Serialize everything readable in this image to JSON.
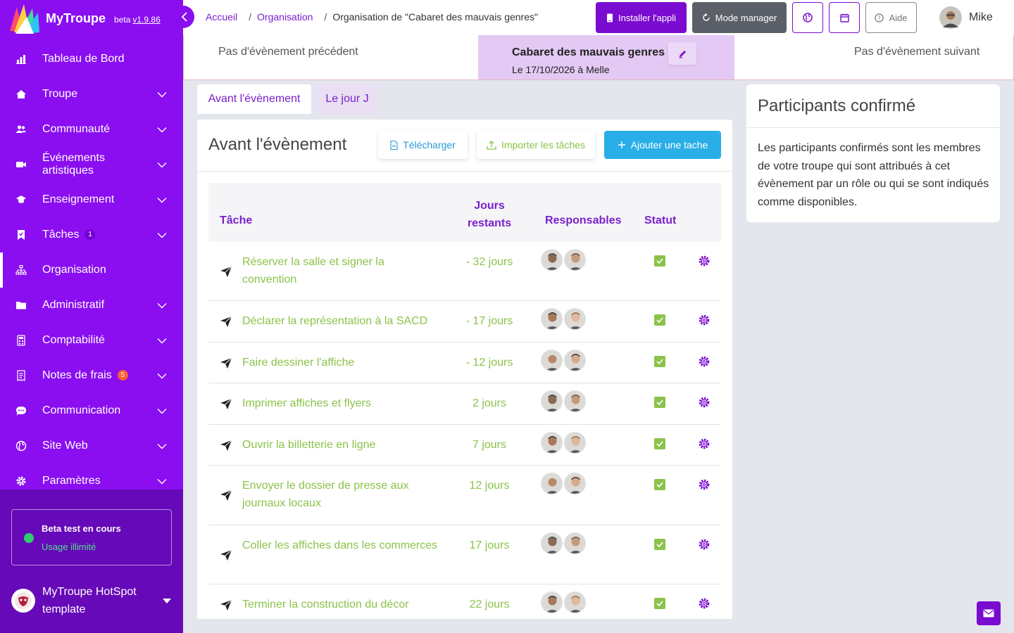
{
  "brand": {
    "name": "MyTroupe",
    "beta": "beta",
    "version": "v1.9.86"
  },
  "nav": [
    {
      "label": "Tableau de Bord",
      "icon": "chart-icon",
      "chevron": false,
      "badge": ""
    },
    {
      "label": "Troupe",
      "icon": "home-icon",
      "chevron": true,
      "badge": ""
    },
    {
      "label": "Communauté",
      "icon": "users-icon",
      "chevron": true,
      "badge": ""
    },
    {
      "label": "Événements artistiques",
      "icon": "video-icon",
      "chevron": true,
      "badge": ""
    },
    {
      "label": "Enseignement",
      "icon": "graduation-icon",
      "chevron": true,
      "badge": ""
    },
    {
      "label": "Tâches",
      "icon": "bookmark-icon",
      "chevron": true,
      "badge": "1"
    },
    {
      "label": "Organisation",
      "icon": "sitemap-icon",
      "chevron": false,
      "badge": "",
      "active": true
    },
    {
      "label": "Administratif",
      "icon": "folder-icon",
      "chevron": true,
      "badge": ""
    },
    {
      "label": "Comptabilité",
      "icon": "calculator-icon",
      "chevron": true,
      "badge": ""
    },
    {
      "label": "Notes de frais",
      "icon": "receipt-icon",
      "chevron": true,
      "badge": "5"
    },
    {
      "label": "Communication",
      "icon": "chat-icon",
      "chevron": true,
      "badge": ""
    },
    {
      "label": "Site Web",
      "icon": "globe-icon",
      "chevron": true,
      "badge": ""
    },
    {
      "label": "Paramètres",
      "icon": "gear-icon",
      "chevron": true,
      "badge": ""
    }
  ],
  "beta_box": {
    "title": "Beta test en cours",
    "subtitle": "Usage illimité"
  },
  "troupe": {
    "name": "MyTroupe HotSpot template"
  },
  "breadcrumb": {
    "home": "Accueil",
    "section": "Organisation",
    "current": "Organisation de \"Cabaret des mauvais genres\""
  },
  "header": {
    "install": "Installer l'appli",
    "manager": "Mode manager",
    "help": "Aide",
    "user": "Mike"
  },
  "event_nav": {
    "prev": "Pas d'évènement précédent",
    "title": "Cabaret des mauvais genres",
    "date": "Le 17/10/2026 à Melle",
    "next": "Pas d'évènement suivant"
  },
  "tabs": {
    "before": "Avant l'évènement",
    "day": "Le jour J"
  },
  "card": {
    "title": "Avant l'évènement",
    "download": "Télécharger",
    "import": "Importer les tâches",
    "add": "Ajouter une tache"
  },
  "table": {
    "headers": {
      "task": "Tâche",
      "days_1": "Jours",
      "days_2": "restants",
      "resp": "Responsables",
      "status": "Statut"
    },
    "rows": [
      {
        "task": "Réserver la salle et signer la convention",
        "days": "- 32 jours",
        "height": 84
      },
      {
        "task": "Déclarer la représentation à la SACD",
        "days": "- 17 jours",
        "height": 59
      },
      {
        "task": "Faire dessiner l'affiche",
        "days": "- 12 jours",
        "height": 58
      },
      {
        "task": "Imprimer affiches et flyers",
        "days": "2 jours",
        "height": 59
      },
      {
        "task": "Ouvrir la billetterie en ligne",
        "days": "7 jours",
        "height": 58
      },
      {
        "task": "Envoyer le dossier de presse aux journaux locaux",
        "days": "12 jours",
        "height": 85
      },
      {
        "task": "Coller les affiches dans les commerces",
        "days": "17 jours",
        "height": 84
      },
      {
        "task": "Terminer la construction du décor",
        "days": "22 jours",
        "height": 59
      }
    ]
  },
  "side": {
    "title": "Participants confirmé",
    "text": "Les participants confirmés sont les membres de votre troupe qui sont attribués à cet évènement par un rôle ou qui se sont indiqués comme disponibles."
  },
  "colors": {
    "sidebar": "#8a0ef0",
    "accent": "#7a1fcc",
    "green": "#8bc34a",
    "blue": "#29aee8"
  }
}
